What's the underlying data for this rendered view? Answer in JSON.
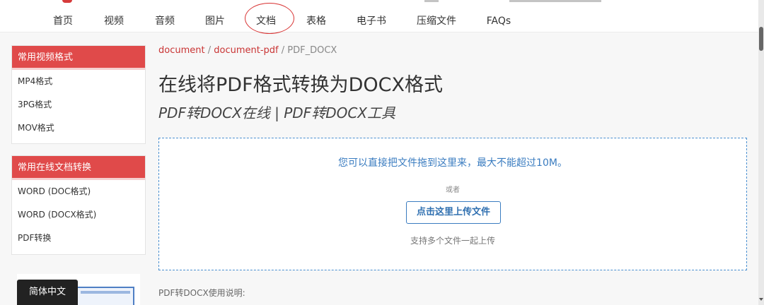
{
  "nav": {
    "items": [
      {
        "label": "首页"
      },
      {
        "label": "视频"
      },
      {
        "label": "音频"
      },
      {
        "label": "图片"
      },
      {
        "label": "文档"
      },
      {
        "label": "表格"
      },
      {
        "label": "电子书"
      },
      {
        "label": "压缩文件"
      },
      {
        "label": "FAQs"
      }
    ],
    "active_label": "文档",
    "accent_color": "#d83434"
  },
  "sidebar": {
    "video_box": {
      "title": "常用视频格式",
      "items": [
        {
          "label": "MP4格式"
        },
        {
          "label": "3PG格式"
        },
        {
          "label": "MOV格式"
        }
      ]
    },
    "doc_box": {
      "title": "常用在线文档转换",
      "items": [
        {
          "label": "WORD (DOC格式)"
        },
        {
          "label": "WORD (DOCX格式)"
        },
        {
          "label": "PDF转换"
        }
      ]
    },
    "language_button": "简体中文"
  },
  "breadcrumb": {
    "items": [
      {
        "label": "document"
      },
      {
        "label": "document-pdf"
      },
      {
        "label": "PDF_DOCX"
      }
    ],
    "separator": " / "
  },
  "main": {
    "title": "在线将PDF格式转换为DOCX格式",
    "subtitle": "PDF转DOCX在线 | PDF转DOCX工具",
    "dropzone": {
      "hint": "您可以直接把文件拖到这里来，最大不能超过10M。",
      "or": "或者",
      "upload_button": "点击这里上传文件",
      "multi_hint": "支持多个文件一起上传"
    },
    "usage_heading": "PDF转DOCX使用说明:"
  }
}
